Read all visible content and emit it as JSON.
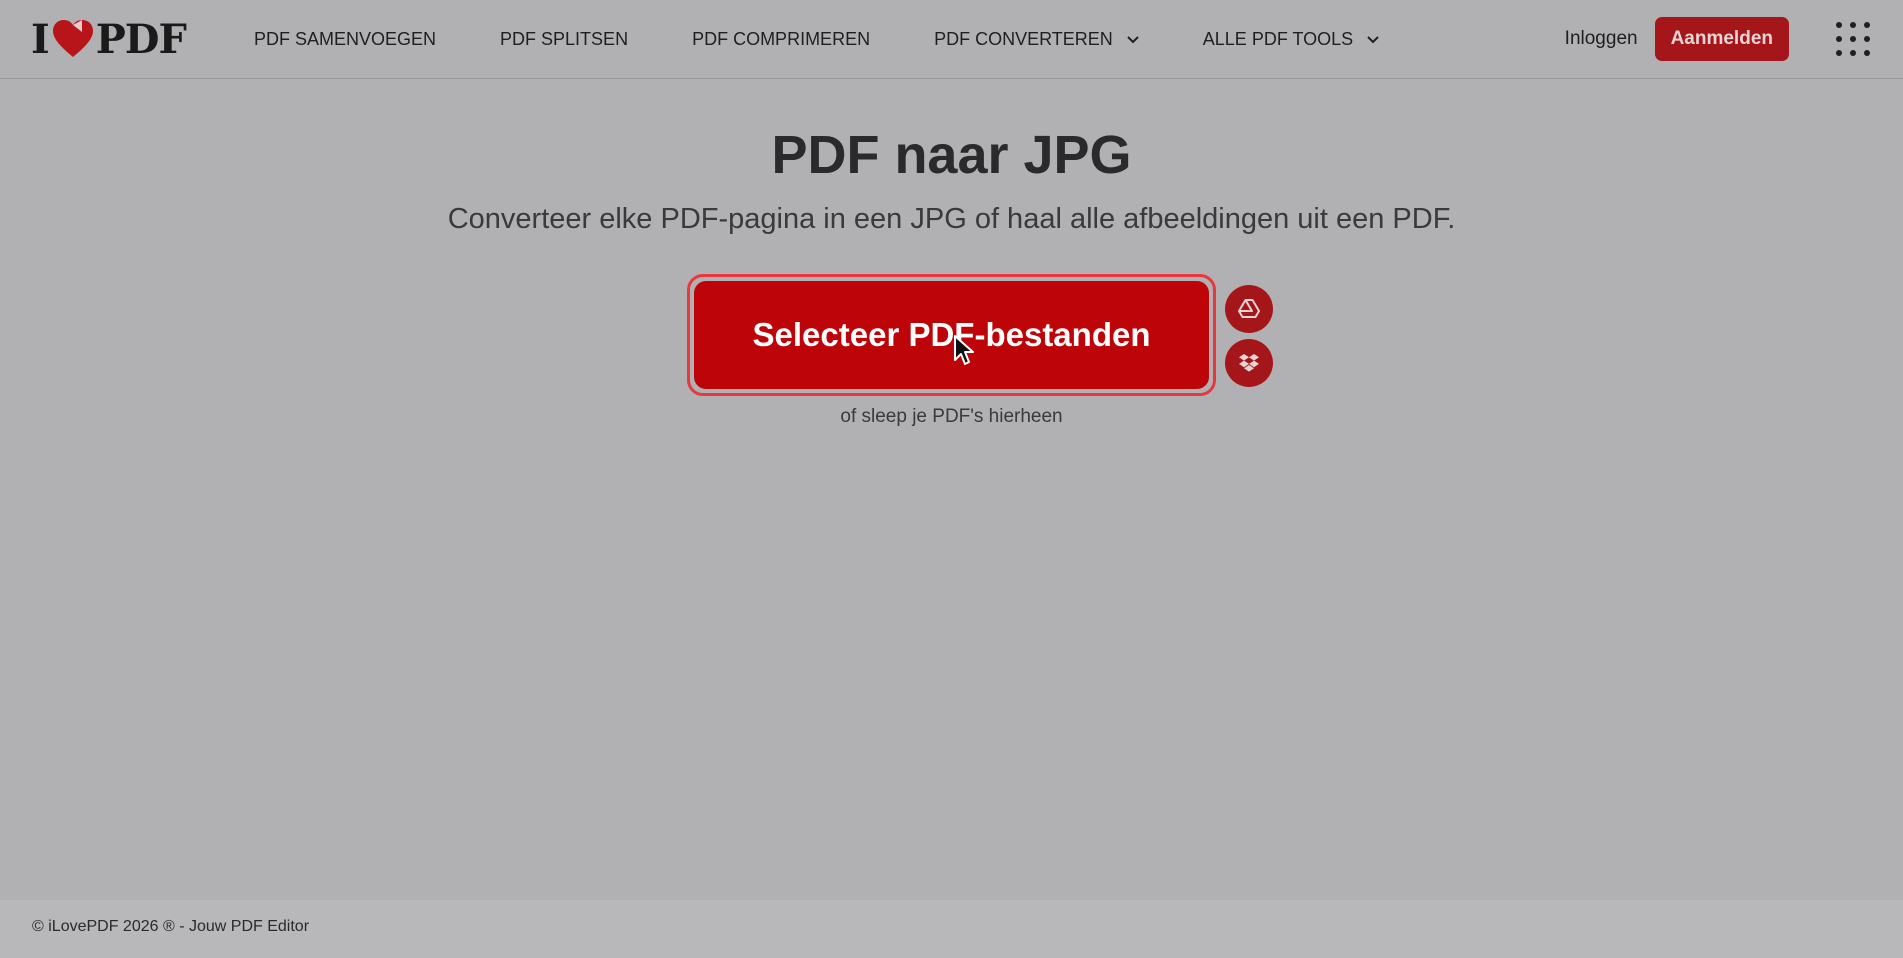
{
  "header": {
    "logo": {
      "left": "I",
      "right": "PDF"
    },
    "nav": [
      {
        "label": "PDF SAMENVOEGEN",
        "dropdown": false
      },
      {
        "label": "PDF SPLITSEN",
        "dropdown": false
      },
      {
        "label": "PDF COMPRIMEREN",
        "dropdown": false
      },
      {
        "label": "PDF CONVERTEREN",
        "dropdown": true
      },
      {
        "label": "ALLE PDF TOOLS",
        "dropdown": true
      }
    ],
    "login_label": "Inloggen",
    "signup_label": "Aanmelden",
    "apps_icon": "grid-icon"
  },
  "main": {
    "title": "PDF naar JPG",
    "subtitle": "Converteer elke PDF-pagina in een JPG of haal alle afbeeldingen uit een PDF.",
    "select_button_label": "Selecteer PDF-bestanden",
    "drop_hint": "of sleep je PDF's hierheen",
    "cloud_buttons": [
      {
        "icon": "google-drive-icon"
      },
      {
        "icon": "dropbox-icon"
      }
    ]
  },
  "footer": {
    "text": "© iLovePDF 2026 ® - Jouw PDF Editor"
  },
  "colors": {
    "brand_red": "#bc0409",
    "brand_dark_red": "#a5161a",
    "overlay_bg": "#b1b1b3"
  }
}
